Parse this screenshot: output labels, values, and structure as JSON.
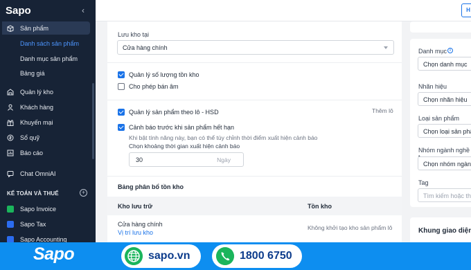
{
  "sidebar": {
    "logo": "Sapo",
    "items": [
      {
        "label": "Sản phẩm",
        "icon": "box-icon"
      },
      {
        "label": "Quản lý kho",
        "icon": "warehouse-icon"
      },
      {
        "label": "Khách hàng",
        "icon": "user-icon"
      },
      {
        "label": "Khuyến mại",
        "icon": "gift-icon"
      },
      {
        "label": "Sổ quỹ",
        "icon": "wallet-icon"
      },
      {
        "label": "Báo cáo",
        "icon": "report-icon"
      },
      {
        "label": "Chat OmniAI",
        "icon": "chat-icon"
      }
    ],
    "sub_items": [
      "Danh sách sản phẩm",
      "Danh mục sản phẩm",
      "Bảng giá"
    ],
    "section_title": "KẾ TOÁN VÀ THUẾ",
    "apps": [
      "Sapo Invoice",
      "Sapo Tax",
      "Sapo Accounting"
    ]
  },
  "form": {
    "warehouse_label": "Lưu kho tại",
    "warehouse_value": "Cửa hàng chính",
    "manage_stock_label": "Quản lý số lượng tồn kho",
    "allow_negative_label": "Cho phép bán âm",
    "batch_label": "Quản lý sản phẩm theo lô - HSD",
    "more_link": "Thêm lô",
    "expiry_warning_label": "Cảnh báo trước khi sản phẩm hết hạn",
    "expiry_help": "Khi bật tính năng này, bạn có thể tùy chỉnh thời điểm xuất hiện cảnh báo",
    "period_label": "Chọn khoảng thời gian xuất hiện cảnh báo",
    "period_value": "30",
    "period_unit": "Ngày",
    "stock_section_title": "Bảng phân bổ tồn kho",
    "table_headers": [
      "Kho lưu trữ",
      "Tồn kho"
    ],
    "table_row": {
      "warehouse": "Cửa hàng chính",
      "location_link": "Vị trí lưu kho",
      "stock_note": "Không khởi tạo kho sản phẩm lô"
    },
    "checks": {
      "manage_stock": true,
      "allow_negative": false,
      "batch": true,
      "expiry_warning": true
    }
  },
  "right_panel": {
    "category_label": "Danh mục",
    "category_value": "Chọn danh mục",
    "brand_label": "Nhãn hiệu",
    "brand_value": "Chọn nhãn hiệu",
    "type_label": "Loại sản phẩm",
    "type_value": "Chọn loại sản phẩm",
    "industry_label": "Nhóm ngành nghề t",
    "industry_value": "Chọn nhóm ngành",
    "tag_label": "Tag",
    "tag_placeholder": "Tìm kiếm hoặc thêm",
    "section_title": "Khung giao diện"
  },
  "top_button_label": "H",
  "banner": {
    "logo": "Sapo",
    "website": "sapo.vn",
    "phone": "1800 6750",
    "colors": {
      "banner": "#0d8ef0",
      "icon": "#1bb55c"
    }
  },
  "colors": {
    "sidebar": "#172336",
    "accent": "#1a73e8",
    "link": "#4d96ff"
  }
}
